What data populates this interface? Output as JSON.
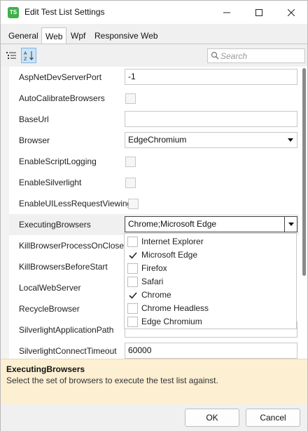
{
  "window": {
    "title": "Edit Test List Settings",
    "app_icon_text": "TS"
  },
  "tabs": [
    {
      "label": "General",
      "active": false
    },
    {
      "label": "Web",
      "active": true
    },
    {
      "label": "Wpf",
      "active": false
    },
    {
      "label": "Responsive Web",
      "active": false
    }
  ],
  "search": {
    "placeholder": "Search"
  },
  "properties": [
    {
      "name": "AspNetDevServerPort",
      "kind": "text",
      "value": "-1"
    },
    {
      "name": "AutoCalibrateBrowsers",
      "kind": "checkbox"
    },
    {
      "name": "BaseUrl",
      "kind": "text",
      "value": ""
    },
    {
      "name": "Browser",
      "kind": "dropdown",
      "value": "EdgeChromium"
    },
    {
      "name": "EnableScriptLogging",
      "kind": "checkbox"
    },
    {
      "name": "EnableSilverlight",
      "kind": "checkbox"
    },
    {
      "name": "EnableUILessRequestViewing",
      "kind": "checkbox"
    },
    {
      "name": "ExecutingBrowsers",
      "kind": "dropdown-open",
      "value": "Chrome;Microsoft Edge"
    },
    {
      "name": "KillBrowserProcessOnClose",
      "kind": "covered"
    },
    {
      "name": "KillBrowsersBeforeStart",
      "kind": "covered"
    },
    {
      "name": "LocalWebServer",
      "kind": "covered"
    },
    {
      "name": "RecycleBrowser",
      "kind": "covered"
    },
    {
      "name": "SilverlightApplicationPath",
      "kind": "covered"
    },
    {
      "name": "SilverlightConnectTimeout",
      "kind": "text",
      "value": "60000"
    }
  ],
  "browser_options": [
    {
      "label": "Internet Explorer",
      "checked": false
    },
    {
      "label": "Microsoft Edge",
      "checked": true
    },
    {
      "label": "Firefox",
      "checked": false
    },
    {
      "label": "Safari",
      "checked": false
    },
    {
      "label": "Chrome",
      "checked": true
    },
    {
      "label": "Chrome Headless",
      "checked": false
    },
    {
      "label": "Edge Chromium",
      "checked": false
    }
  ],
  "description": {
    "title": "ExecutingBrowsers",
    "text": "Select the set of browsers to execute the test list against."
  },
  "buttons": {
    "ok": "OK",
    "cancel": "Cancel"
  },
  "colors": {
    "app_icon": "#3fb14a",
    "description_bg": "#fcefd2",
    "sort_pressed": "#cce4f7"
  }
}
